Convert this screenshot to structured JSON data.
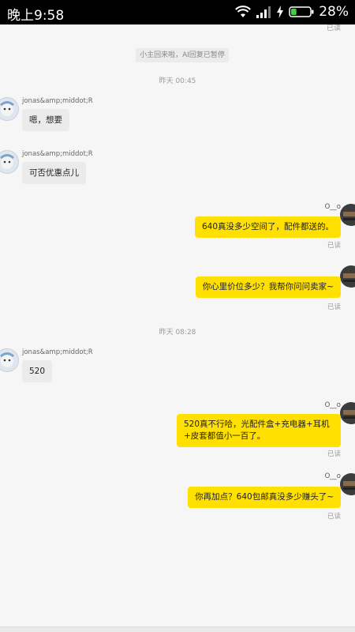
{
  "status_bar": {
    "time": "晚上9:58",
    "battery_percent": "28%",
    "battery_level": 0.28,
    "icons": [
      "wifi-icon",
      "signal-icon",
      "charging-bolt-icon",
      "battery-icon"
    ]
  },
  "chat": {
    "top_read": "已读",
    "system_note": "小主回来啦，AI回复已暂停",
    "dividers": [
      "昨天 00:45",
      "昨天 08:28"
    ],
    "contact_name": "jonas&amp;middot;R",
    "my_name": "O__o",
    "read_label": "已读",
    "messages": [
      {
        "dir": "in",
        "text": "嗯，想要"
      },
      {
        "dir": "in",
        "text": "可否优惠点儿"
      },
      {
        "dir": "out",
        "text": "640真没多少空间了，配件都送的。"
      },
      {
        "dir": "out",
        "text": "你心里价位多少？我帮你问问卖家~"
      },
      {
        "dir": "in",
        "text": "520"
      },
      {
        "dir": "out",
        "text": "520真不行哈，光配件盒+充电器+耳机+皮套都值小一百了。"
      },
      {
        "dir": "out",
        "text": "你再加点？640包邮真没多少赚头了~"
      }
    ],
    "colors": {
      "outgoing_bubble": "#ffe000",
      "incoming_bubble": "#ebebeb",
      "background": "#f6f6f6"
    }
  }
}
